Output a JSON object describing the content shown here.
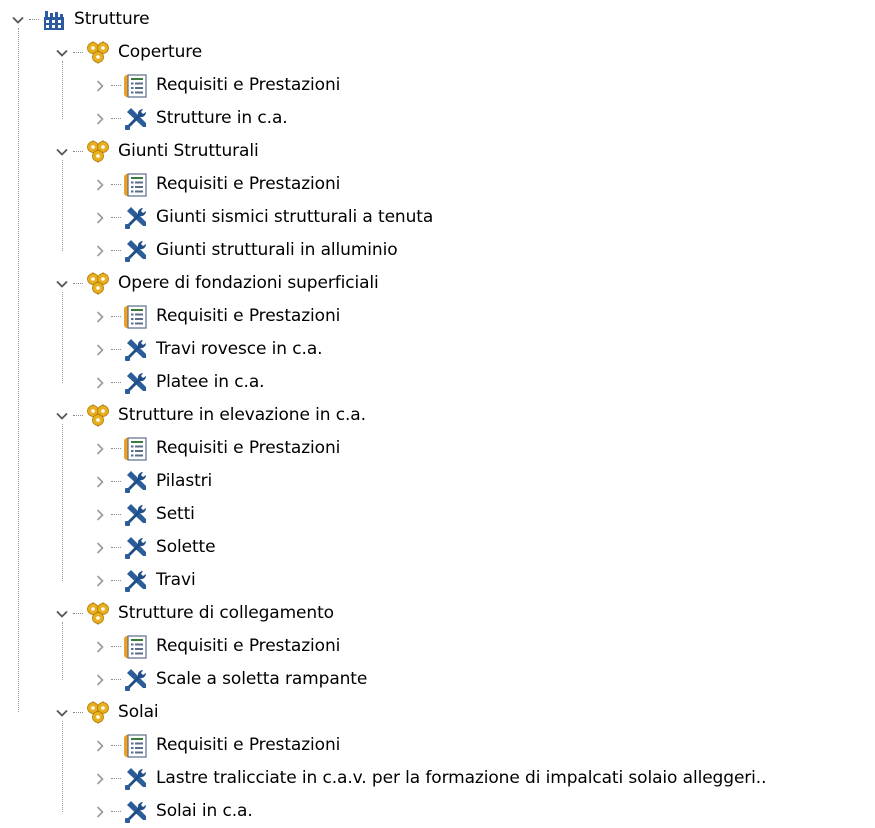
{
  "tree": {
    "root": {
      "label": "Strutture",
      "icon": "building-icon",
      "expanded": true
    },
    "groups": [
      {
        "label": "Coperture",
        "icon": "gears-icon",
        "expanded": true,
        "children": [
          {
            "label": "Requisiti e Prestazioni",
            "icon": "document-icon",
            "expanded": false
          },
          {
            "label": "Strutture in c.a.",
            "icon": "tools-icon",
            "expanded": false
          }
        ]
      },
      {
        "label": "Giunti Strutturali",
        "icon": "gears-icon",
        "expanded": true,
        "children": [
          {
            "label": "Requisiti e Prestazioni",
            "icon": "document-icon",
            "expanded": false
          },
          {
            "label": "Giunti sismici strutturali a tenuta",
            "icon": "tools-icon",
            "expanded": false
          },
          {
            "label": "Giunti strutturali in alluminio",
            "icon": "tools-icon",
            "expanded": false
          }
        ]
      },
      {
        "label": "Opere di fondazioni superficiali",
        "icon": "gears-icon",
        "expanded": true,
        "children": [
          {
            "label": "Requisiti e Prestazioni",
            "icon": "document-icon",
            "expanded": false
          },
          {
            "label": "Travi rovesce in c.a.",
            "icon": "tools-icon",
            "expanded": false
          },
          {
            "label": "Platee in c.a.",
            "icon": "tools-icon",
            "expanded": false
          }
        ]
      },
      {
        "label": "Strutture in elevazione in c.a.",
        "icon": "gears-icon",
        "expanded": true,
        "children": [
          {
            "label": "Requisiti e Prestazioni",
            "icon": "document-icon",
            "expanded": false
          },
          {
            "label": "Pilastri",
            "icon": "tools-icon",
            "expanded": false
          },
          {
            "label": "Setti",
            "icon": "tools-icon",
            "expanded": false
          },
          {
            "label": "Solette",
            "icon": "tools-icon",
            "expanded": false
          },
          {
            "label": "Travi",
            "icon": "tools-icon",
            "expanded": false
          }
        ]
      },
      {
        "label": "Strutture di collegamento",
        "icon": "gears-icon",
        "expanded": true,
        "children": [
          {
            "label": "Requisiti e Prestazioni",
            "icon": "document-icon",
            "expanded": false
          },
          {
            "label": "Scale a soletta rampante",
            "icon": "tools-icon",
            "expanded": false
          }
        ]
      },
      {
        "label": "Solai",
        "icon": "gears-icon",
        "expanded": true,
        "children": [
          {
            "label": "Requisiti e Prestazioni",
            "icon": "document-icon",
            "expanded": false
          },
          {
            "label": "Lastre tralicciate in c.a.v. per la formazione di impalcati solaio alleggeri..",
            "icon": "tools-icon",
            "expanded": false
          },
          {
            "label": "Solai in c.a.",
            "icon": "tools-icon",
            "expanded": false
          }
        ]
      }
    ]
  },
  "colors": {
    "text": "#000000",
    "chevron": "#555555",
    "chevron_collapsed": "#9a9a9a",
    "tree_lines": "#9a9a9a",
    "gear": "#e8b020",
    "document_tab": "#f0a020",
    "tools": "#2a5d9a"
  }
}
